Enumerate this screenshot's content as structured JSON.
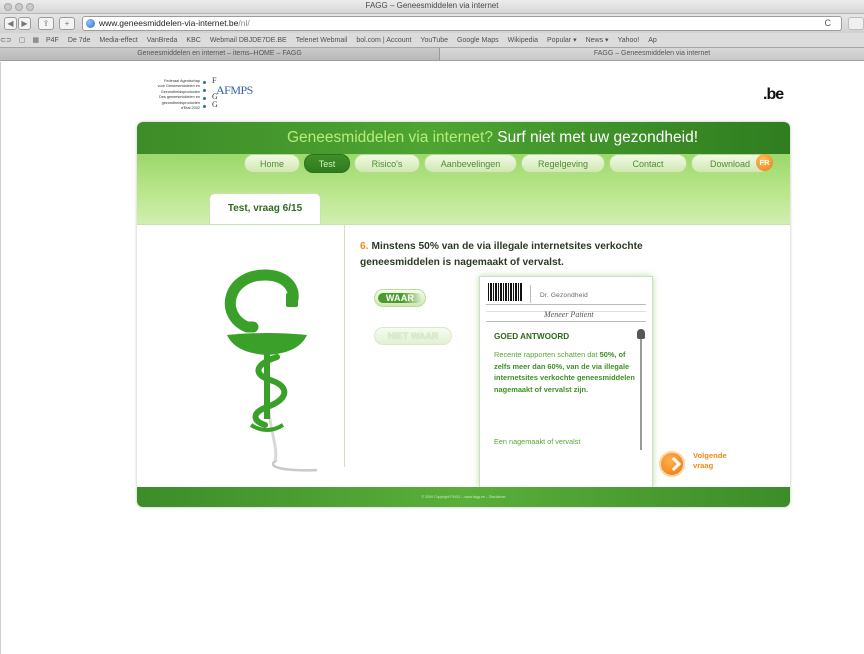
{
  "browser": {
    "window_title": "FAGG – Geneesmiddelen via internet",
    "url_domain": "www.geneesmiddelen-via-internet.be",
    "url_path": "/nl/",
    "reload_label": "C",
    "bookmarks": [
      "P4F",
      "De 7de",
      "Media-effect",
      "VanBreda",
      "KBC",
      "Webmail DBJDE7DE.BE",
      "Telenet Webmail",
      "bol.com | Account",
      "YouTube",
      "Google Maps",
      "Wikipedia",
      "Popular ▾",
      "News ▾",
      "Yahoo!",
      "Ap"
    ],
    "tabs": [
      {
        "label": "Geneesmiddelen en internet – items–HOME – FAGG"
      },
      {
        "label": "FAGG – Geneesmiddelen via internet"
      }
    ]
  },
  "header": {
    "agency_lines": [
      "Federaal Agentschap",
      "voor Geneesmiddelen en",
      "Gezondheidsproducten",
      "Des geneesmiddelen en",
      "gezondheidsproducten",
      "d'Etat 2002"
    ],
    "agency_letters": [
      "F",
      "A",
      "G",
      "G"
    ],
    "agency_acronym": "AFMPS",
    "be_logo": ".be"
  },
  "site": {
    "slogan_question": "Geneesmiddelen via internet?",
    "slogan_statement": "Surf niet met uw gezondheid!",
    "menu": [
      {
        "label": "Home",
        "active": false
      },
      {
        "label": "Test",
        "active": true
      },
      {
        "label": "Risico's",
        "active": false
      },
      {
        "label": "Aanbevelingen",
        "active": false
      },
      {
        "label": "Regelgeving",
        "active": false
      },
      {
        "label": "Contact",
        "active": false
      },
      {
        "label": "Download",
        "active": false
      }
    ],
    "lang_button": "FR",
    "question_tab": "Test, vraag 6/15",
    "question_number": "6.",
    "question_text": "Minstens 50% van de via illegale internetsites verkochte geneesmiddelen is nagemaakt of vervalst.",
    "answer_true": "WAAR",
    "answer_false": "NIET WAAR",
    "card": {
      "doctor": "Dr. Gezondheid",
      "patient": "Meneer Patient",
      "answer_title": "GOED ANTWOORD",
      "answer_intro": "Recente rapporten schatten dat ",
      "answer_bold": "50%, of zelfs meer dan 60%, van de via illegale internetsites verkochte geneesmiddelen nagemaakt of vervalst zijn.",
      "answer_footer": "Een nagemaakt of vervalst"
    },
    "next_label": "Volgende vraag",
    "footer_text": "© 2009 Copyright FAGG – www.fagg.be – Disclaimer",
    "colors": {
      "banner": "#3d8c28",
      "accent": "#f08a18",
      "text_green": "#57a637"
    }
  }
}
